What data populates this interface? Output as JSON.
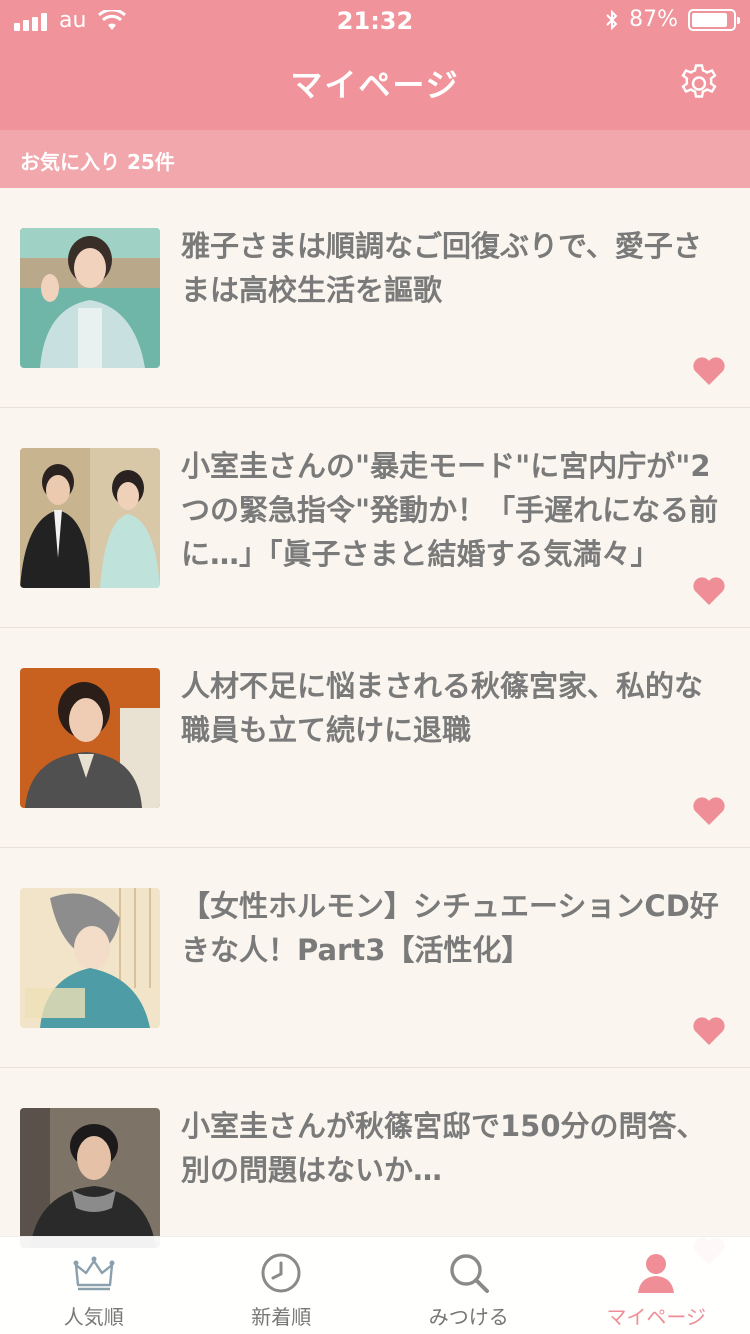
{
  "status": {
    "carrier": "au",
    "time": "21:32",
    "battery": "87%",
    "battery_level": 0.87
  },
  "header": {
    "title": "マイページ"
  },
  "favorites": {
    "label": "お気に入り 25件"
  },
  "articles": [
    {
      "title": "雅子さまは順調なご回復ぶりで、愛子さまは高校生活を謳歌"
    },
    {
      "title": "小室圭さんの\"暴走モード\"に宮内庁が\"2つの緊急指令\"発動か！「手遅れになる前に…」「眞子さまと結婚する気満々」"
    },
    {
      "title": "人材不足に悩まされる秋篠宮家、私的な職員も立て続けに退職"
    },
    {
      "title": "【女性ホルモン】シチュエーションCD好きな人！Part3【活性化】"
    },
    {
      "title": "小室圭さんが秋篠宮邸で150分の問答、別の問題はないか…"
    }
  ],
  "tabs": [
    {
      "label": "人気順",
      "icon": "crown-icon"
    },
    {
      "label": "新着順",
      "icon": "clock-icon"
    },
    {
      "label": "みつける",
      "icon": "search-icon"
    },
    {
      "label": "マイページ",
      "icon": "person-icon"
    }
  ],
  "colors": {
    "accent": "#f0939a",
    "subbar": "#f2a7ad",
    "heart": "#ef8e96",
    "background": "#faf6ef",
    "text": "#7a7a7a"
  }
}
